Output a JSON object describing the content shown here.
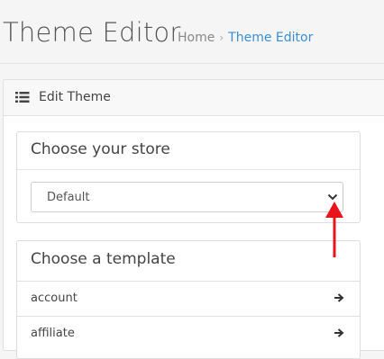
{
  "header": {
    "title": "Theme Editor",
    "breadcrumb": [
      {
        "label": "Home"
      },
      {
        "label": "Theme Editor"
      }
    ]
  },
  "panel": {
    "title": "Edit Theme",
    "icon": "list-icon"
  },
  "store_section": {
    "title": "Choose your store",
    "selected_store": "Default",
    "icon": "chevron-down-icon"
  },
  "template_section": {
    "title": "Choose a template",
    "items": [
      {
        "label": "account",
        "icon": "arrow-right-icon"
      },
      {
        "label": "affiliate",
        "icon": "arrow-right-icon"
      }
    ]
  },
  "colors": {
    "link": "#3b8ed3",
    "annotation": "#e8141a"
  }
}
